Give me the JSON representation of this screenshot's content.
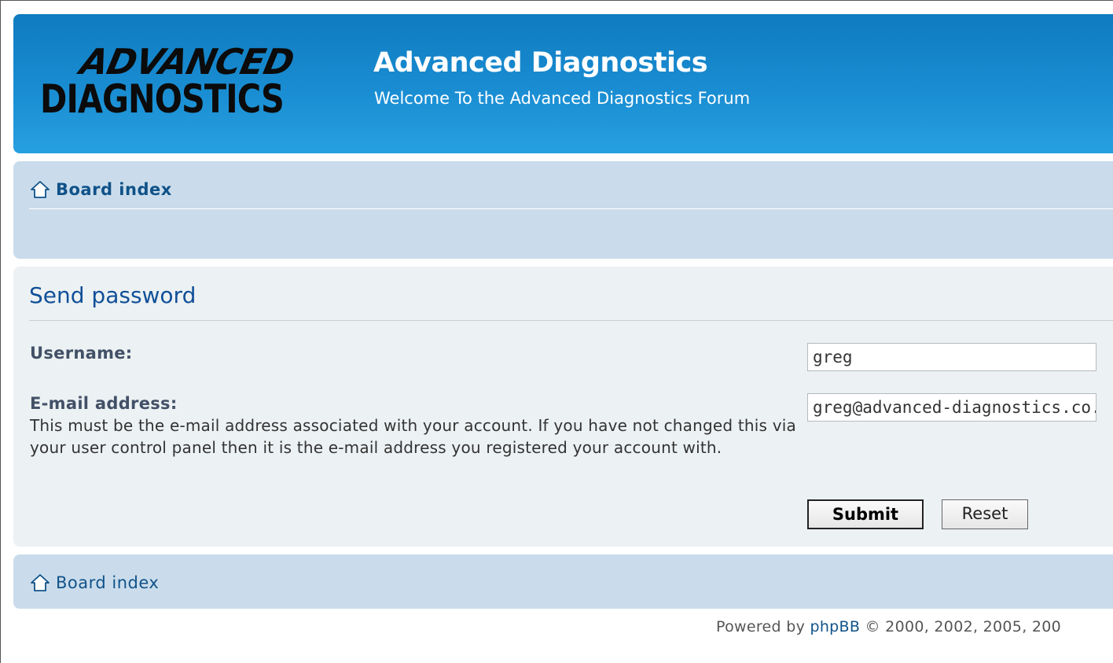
{
  "header": {
    "logo_line1": "ADVANCED",
    "logo_line2": "DIAGNOSTICS",
    "site_title": "Advanced Diagnostics",
    "site_description": "Welcome To the Advanced Diagnostics Forum"
  },
  "nav": {
    "board_index": "Board index",
    "icon": "home-icon"
  },
  "form": {
    "title": "Send password",
    "username_label": "Username:",
    "username_value": "greg",
    "email_label": "E-mail address:",
    "email_value": "greg@advanced-diagnostics.co.",
    "email_explain": "This must be the e-mail address associated with your account. If you have not changed this via your user control panel then it is the e-mail address you registered your account with.",
    "submit_label": "Submit",
    "reset_label": "Reset"
  },
  "footer_nav": {
    "board_index": "Board index"
  },
  "copyright": {
    "prefix": "Powered by ",
    "link": "phpBB",
    "suffix": " © 2000, 2002, 2005, 200"
  },
  "colors": {
    "header_blue": "#1a8dd2",
    "nav_bg": "#cadceb",
    "panel_bg": "#ecf1f3",
    "link": "#105289"
  }
}
